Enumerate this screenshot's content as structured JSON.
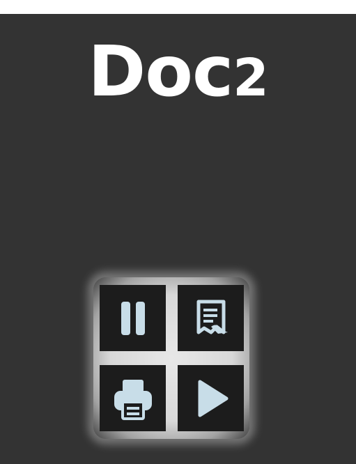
{
  "app": {
    "title": "Doc",
    "title_suffix": "2"
  },
  "controls": {
    "pause": {
      "icon": "pause-icon"
    },
    "document": {
      "icon": "document-icon"
    },
    "print": {
      "icon": "printer-icon"
    },
    "play": {
      "icon": "play-icon"
    }
  },
  "colors": {
    "background": "#333333",
    "title": "#ffffff",
    "icon": "#c8dde8",
    "button": "#1c1c1c",
    "glow": "#e6e6e6"
  }
}
